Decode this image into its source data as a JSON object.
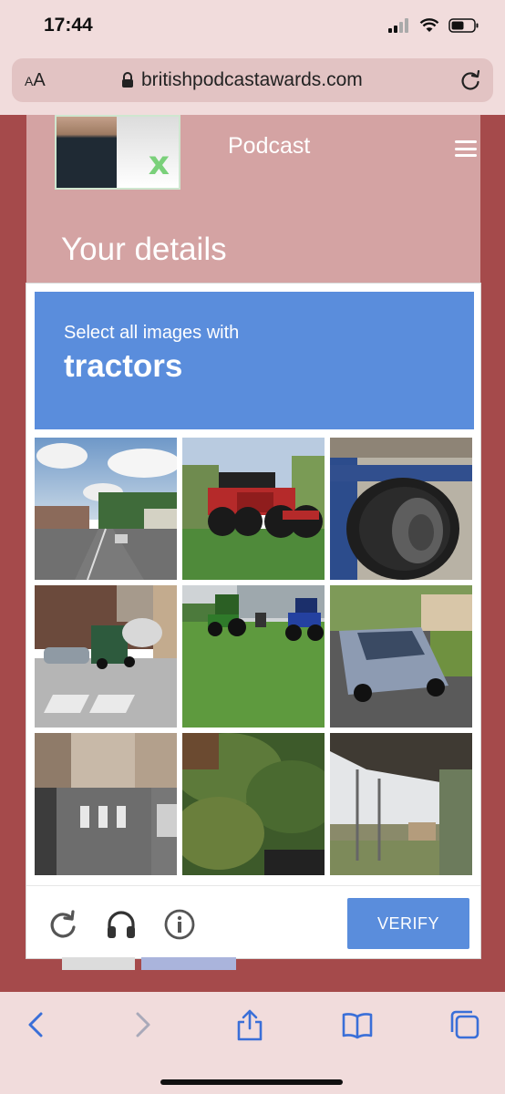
{
  "status_bar": {
    "time": "17:44"
  },
  "browser": {
    "aa_label_small": "A",
    "aa_label_big": "A",
    "url": "britishpodcastawards.com"
  },
  "site": {
    "podcast_label": "Podcast",
    "page_title": "Your details"
  },
  "captcha": {
    "instruction": "Select all images with",
    "target": "tractors",
    "verify_label": "VERIFY",
    "tiles": [
      "street intersection",
      "red tractor on grass",
      "tractor tire closeup",
      "cement truck at crossing",
      "green and blue tractors on lawn",
      "blue SUV in driveway",
      "city street with parked cars",
      "hedge and bushes",
      "highway overpass"
    ]
  },
  "colors": {
    "captcha_blue": "#5a8ddc",
    "page_bg": "#a54a4b",
    "card_bg": "#d4a3a3",
    "browser_bg": "#f1dcdc"
  },
  "icons": {
    "status": [
      "signal-icon",
      "wifi-icon",
      "battery-icon"
    ],
    "browser": [
      "lock-icon",
      "reload-icon"
    ],
    "captcha_footer": [
      "reload-icon",
      "headphones-icon",
      "info-icon"
    ],
    "toolbar": [
      "back-icon",
      "forward-icon",
      "share-icon",
      "bookmarks-icon",
      "tabs-icon"
    ]
  }
}
